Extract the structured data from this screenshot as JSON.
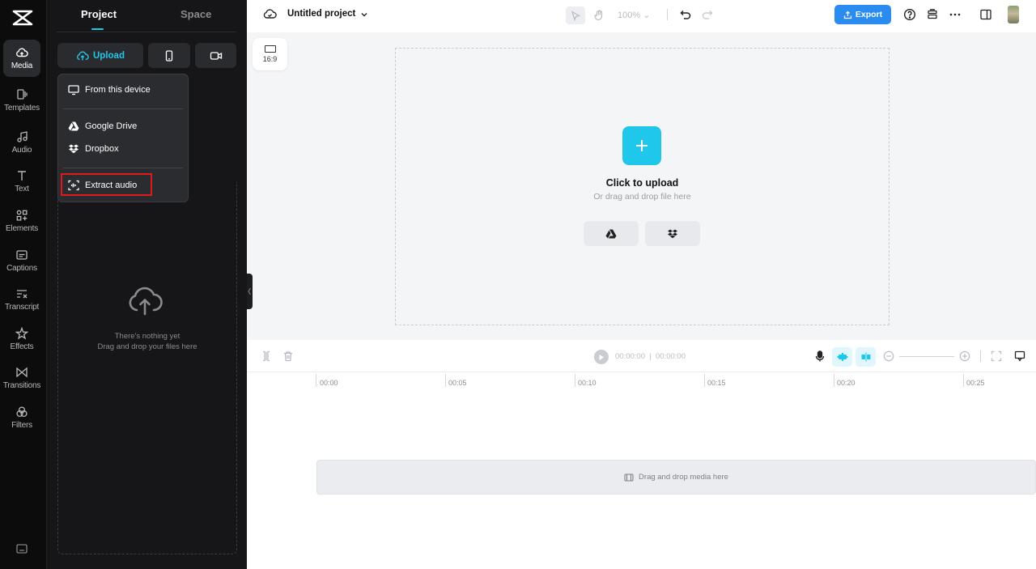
{
  "rail": {
    "items": [
      {
        "label": "Media",
        "icon": "cloud-upload-icon",
        "active": true
      },
      {
        "label": "Templates",
        "icon": "templates-icon"
      },
      {
        "label": "Audio",
        "icon": "music-note-icon"
      },
      {
        "label": "Text",
        "icon": "text-icon"
      },
      {
        "label": "Elements",
        "icon": "elements-icon"
      },
      {
        "label": "Captions",
        "icon": "captions-icon"
      },
      {
        "label": "Transcript",
        "icon": "transcript-icon"
      },
      {
        "label": "Effects",
        "icon": "effects-icon"
      },
      {
        "label": "Transitions",
        "icon": "transitions-icon"
      },
      {
        "label": "Filters",
        "icon": "filters-icon"
      }
    ]
  },
  "panel": {
    "tabs": [
      {
        "label": "Project",
        "active": true
      },
      {
        "label": "Space",
        "active": false
      }
    ],
    "upload_label": "Upload",
    "empty_line1": "There's nothing yet",
    "empty_line2": "Drag and drop your files here"
  },
  "upload_menu": {
    "items": [
      {
        "label": "From this device",
        "icon": "monitor-icon"
      },
      {
        "label": "Google Drive",
        "icon": "google-drive-icon"
      },
      {
        "label": "Dropbox",
        "icon": "dropbox-icon"
      },
      {
        "label": "Extract audio",
        "icon": "extract-audio-icon",
        "highlighted": true
      }
    ]
  },
  "topbar": {
    "project_title": "Untitled project",
    "zoom": "100%",
    "export_label": "Export"
  },
  "canvas": {
    "ratio": "16:9",
    "upload_title": "Click to upload",
    "upload_subtitle": "Or drag and drop file here"
  },
  "timeline": {
    "current_time": "00:00:00",
    "total_time": "00:00:00",
    "ruler": [
      "00:00",
      "00:05",
      "00:10",
      "00:15",
      "00:20",
      "00:25"
    ],
    "track_placeholder": "Drag and drop media here"
  },
  "colors": {
    "accent": "#1fc7ea",
    "export": "#2a8cf0",
    "highlight_box": "#e01a1a",
    "rail_bg": "#0c0c0d",
    "panel_bg": "#161618"
  }
}
